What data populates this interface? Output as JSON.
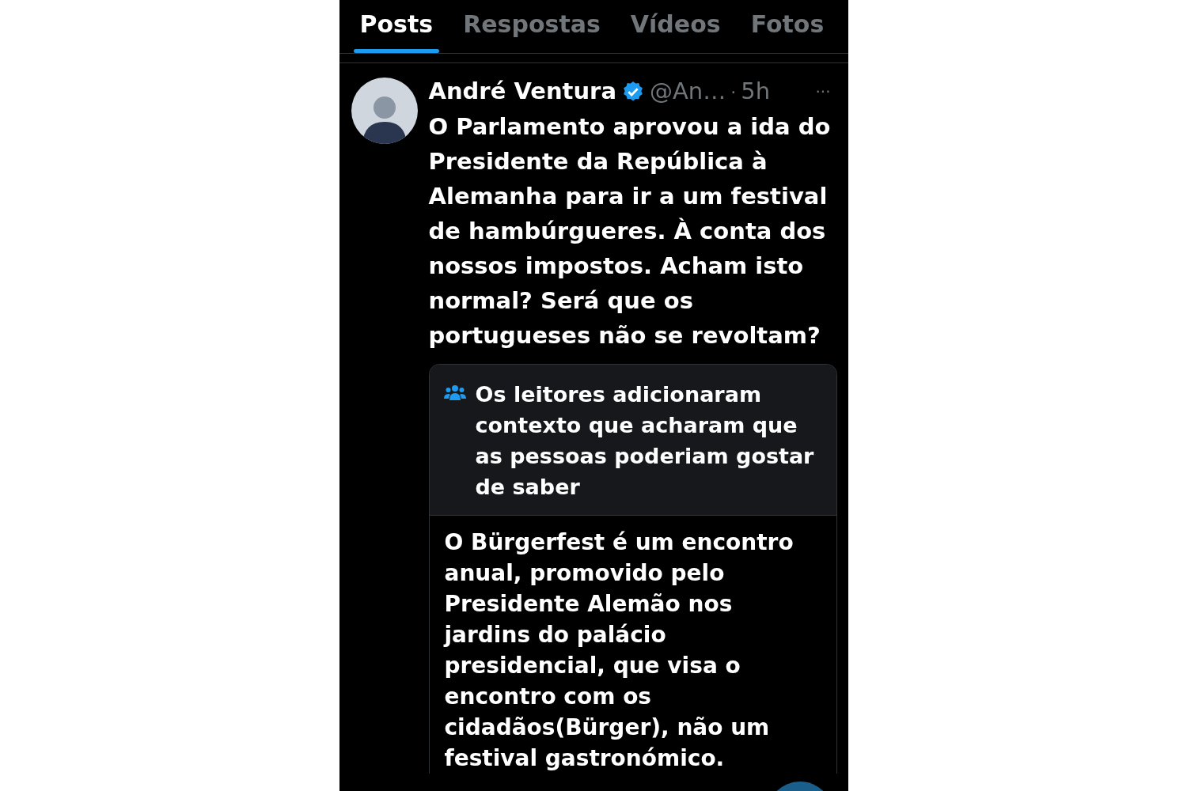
{
  "tabs": [
    {
      "label": "Posts",
      "selected": true
    },
    {
      "label": "Respostas",
      "selected": false
    },
    {
      "label": "Vídeos",
      "selected": false
    },
    {
      "label": "Fotos",
      "selected": false
    }
  ],
  "post": {
    "author": "André Ventura",
    "verified": true,
    "handle": "@An…",
    "separator": "·",
    "time": "5h",
    "more": "···",
    "text": "O Parlamento aprovou a ida do Presidente da República à Alemanha para ir a um festival de hambúrgueres. À conta dos nossos impostos. Acham isto normal? Será que os portugueses não se revoltam?",
    "note": {
      "heading": "Os leitores adicionaram contexto que acharam que as pessoas poderiam gostar de saber",
      "body": "O Bürgerfest é um encontro anual, promovido pelo Presidente Alemão nos jardins do palácio presidencial, que visa o encontro com os cidadãos(Bürger), não um festival gastronómico."
    }
  }
}
